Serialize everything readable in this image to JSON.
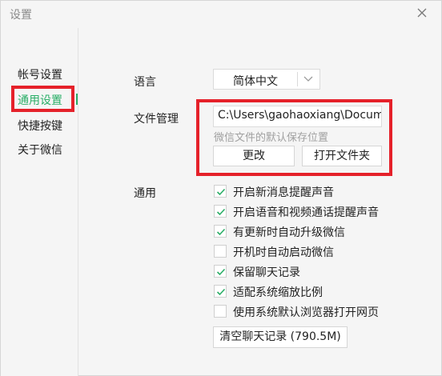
{
  "window": {
    "title": "设置"
  },
  "sidebar": {
    "items": [
      {
        "label": "帐号设置",
        "active": false
      },
      {
        "label": "通用设置",
        "active": true
      },
      {
        "label": "快捷按键",
        "active": false
      },
      {
        "label": "关于微信",
        "active": false
      }
    ]
  },
  "language": {
    "label": "语言",
    "selected": "简体中文"
  },
  "file_management": {
    "label": "文件管理",
    "path_value": "C:\\Users\\gaohaoxiang\\Documents\\WeChat Files",
    "hint": "微信文件的默认保存位置",
    "change_label": "更改",
    "open_folder_label": "打开文件夹"
  },
  "general": {
    "label": "通用",
    "options": [
      {
        "label": "开启新消息提醒声音",
        "checked": true
      },
      {
        "label": "开启语音和视频通话提醒声音",
        "checked": true
      },
      {
        "label": "有更新时自动升级微信",
        "checked": true
      },
      {
        "label": "开机时自动启动微信",
        "checked": false
      },
      {
        "label": "保留聊天记录",
        "checked": true
      },
      {
        "label": "适配系统缩放比例",
        "checked": true
      },
      {
        "label": "使用系统默认浏览器打开网页",
        "checked": false
      }
    ],
    "clear_history_label": "清空聊天记录 (790.5M)"
  },
  "colors": {
    "accent": "#2aae67",
    "highlight_box": "#e5212a",
    "checkmark": "#2aae67"
  }
}
